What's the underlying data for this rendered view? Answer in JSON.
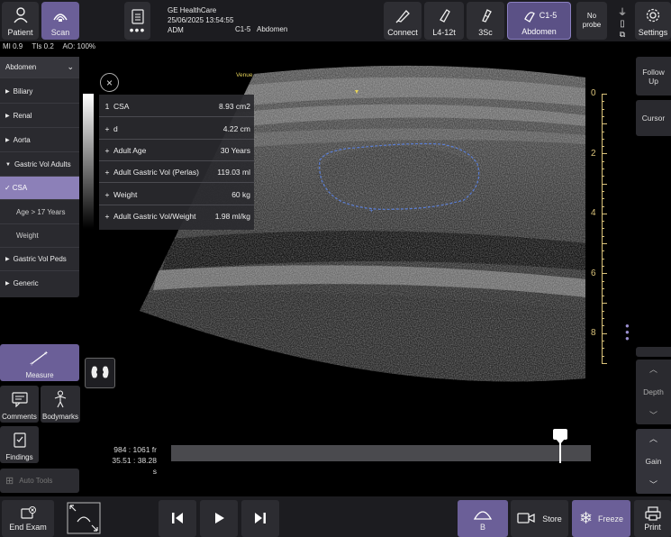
{
  "topbar": {
    "patient_label": "Patient",
    "scan_label": "Scan",
    "clinic": "GE HealthCare",
    "datetime": "25/06/2025 13:54:55",
    "user": "ADM",
    "probe_preset": "C1-5",
    "exam": "Abdomen",
    "connect_label": "Connect",
    "probe1_label": "L4-12t",
    "probe2_label": "3Sc",
    "probe_active_name": "C1-5",
    "probe_active_exam": "Abdomen",
    "no_probe_label": "No probe",
    "settings_label": "Settings"
  },
  "status": {
    "mi": "MI 0.9",
    "tis": "TIs 0.2",
    "ao": "AO: 100%"
  },
  "menu": {
    "header": "Abdomen",
    "items": [
      {
        "label": "Biliary"
      },
      {
        "label": "Renal"
      },
      {
        "label": "Aorta"
      },
      {
        "label": "Gastric Vol Adults"
      },
      {
        "label": "CSA"
      },
      {
        "label": "Age > 17 Years"
      },
      {
        "label": "Weight"
      },
      {
        "label": "Gastric Vol Peds"
      },
      {
        "label": "Generic"
      }
    ]
  },
  "results": {
    "rows": [
      {
        "marker": "1",
        "label": "CSA",
        "value": "8.93 cm2"
      },
      {
        "marker": "+",
        "label": "d",
        "value": "4.22 cm"
      },
      {
        "marker": "+",
        "label": "Adult Age",
        "value": "30 Years"
      },
      {
        "marker": "+",
        "label": "Adult Gastric Vol (Perlas)",
        "value": "119.03 ml"
      },
      {
        "marker": "+",
        "label": "Weight",
        "value": "60 kg"
      },
      {
        "marker": "+",
        "label": "Adult Gastric Vol/Weight",
        "value": "1.98 ml/kg"
      }
    ]
  },
  "image": {
    "marker_label": "Venue"
  },
  "depth_scale": {
    "ticks": [
      "0",
      "2",
      "4",
      "6",
      "8"
    ]
  },
  "tools": {
    "measure_label": "Measure",
    "comments_label": "Comments",
    "bodymarks_label": "Bodymarks",
    "findings_label": "Findings",
    "autotools_label": "Auto Tools"
  },
  "cine": {
    "frames": "984 : 1061 fr",
    "time": "35.51 : 38.28 s",
    "position_fraction": 0.927
  },
  "right": {
    "follow_up_label": "Follow Up",
    "cursor_label": "Cursor",
    "depth_label": "Depth",
    "gain_label": "Gain"
  },
  "bottom": {
    "end_exam_label": "End Exam",
    "b_label": "B",
    "store_label": "Store",
    "freeze_label": "Freeze",
    "print_label": "Print"
  },
  "colors": {
    "accent": "#6b5f98",
    "menu_selected": "#8c80b8",
    "scale": "#d9c27a",
    "trace": "#5b7fd6"
  }
}
